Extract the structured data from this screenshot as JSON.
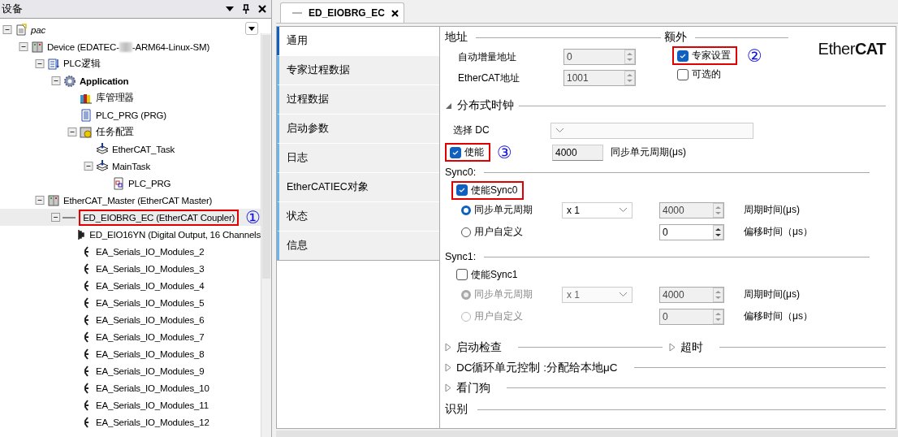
{
  "device_panel": {
    "title": "设备",
    "tree": [
      {
        "label": "pac",
        "kind": "project",
        "selected": false,
        "expanded": true,
        "children": [
          {
            "label": "Device (EDATEC-",
            "label_tail": "-ARM64-Linux-SM)",
            "kind": "device",
            "selected": false,
            "expanded": true,
            "children": [
              {
                "label": "PLC逻辑",
                "kind": "plc",
                "selected": false,
                "expanded": true,
                "children": [
                  {
                    "label": "Application",
                    "kind": "application",
                    "selected": false,
                    "expanded": true,
                    "children": [
                      {
                        "label": "库管理器",
                        "kind": "library",
                        "selected": false
                      },
                      {
                        "label": "PLC_PRG (PRG)",
                        "kind": "program",
                        "selected": false
                      },
                      {
                        "label": "任务配置",
                        "kind": "taskconfig",
                        "selected": false,
                        "expanded": true,
                        "children": [
                          {
                            "label": "EtherCAT_Task",
                            "kind": "task",
                            "selected": false
                          },
                          {
                            "label": "MainTask",
                            "kind": "task",
                            "selected": false,
                            "expanded": true,
                            "children": [
                              {
                                "label": "PLC_PRG",
                                "kind": "call",
                                "selected": false
                              }
                            ]
                          }
                        ]
                      }
                    ]
                  }
                ]
              },
              {
                "label": "EtherCAT_Master (EtherCAT Master)",
                "kind": "device",
                "selected": false,
                "expanded": true,
                "children": [
                  {
                    "label": "ED_EIOBRG_EC (EtherCAT Coupler)",
                    "kind": "coupler",
                    "selected": true,
                    "highlighted": true,
                    "callout": "①",
                    "expanded": true,
                    "children": [
                      {
                        "label": "ED_EIO16YN (Digital Output, 16 Channels",
                        "kind": "module_out",
                        "selected": false
                      },
                      {
                        "label": "EA_Serials_IO_Modules_2",
                        "kind": "module",
                        "selected": false
                      },
                      {
                        "label": "EA_Serials_IO_Modules_3",
                        "kind": "module",
                        "selected": false
                      },
                      {
                        "label": "EA_Serials_IO_Modules_4",
                        "kind": "module",
                        "selected": false
                      },
                      {
                        "label": "EA_Serials_IO_Modules_5",
                        "kind": "module",
                        "selected": false
                      },
                      {
                        "label": "EA_Serials_IO_Modules_6",
                        "kind": "module",
                        "selected": false
                      },
                      {
                        "label": "EA_Serials_IO_Modules_7",
                        "kind": "module",
                        "selected": false
                      },
                      {
                        "label": "EA_Serials_IO_Modules_8",
                        "kind": "module",
                        "selected": false
                      },
                      {
                        "label": "EA_Serials_IO_Modules_9",
                        "kind": "module",
                        "selected": false
                      },
                      {
                        "label": "EA_Serials_IO_Modules_10",
                        "kind": "module",
                        "selected": false
                      },
                      {
                        "label": "EA_Serials_IO_Modules_11",
                        "kind": "module",
                        "selected": false
                      },
                      {
                        "label": "EA_Serials_IO_Modules_12",
                        "kind": "module",
                        "selected": false
                      }
                    ]
                  }
                ]
              }
            ]
          }
        ]
      }
    ]
  },
  "editor_tab": {
    "label": "ED_EIOBRG_EC",
    "selected": true
  },
  "nav": [
    {
      "label": "通用",
      "selected": true
    },
    {
      "label": "专家过程数据",
      "selected": false
    },
    {
      "label": "过程数据",
      "selected": false
    },
    {
      "label": "启动参数",
      "selected": false
    },
    {
      "label": "日志",
      "selected": false
    },
    {
      "label": "EtherCATIEC对象",
      "selected": false
    },
    {
      "label": "状态",
      "selected": false
    },
    {
      "label": "信息",
      "selected": false
    }
  ],
  "address": {
    "title": "地址",
    "fields": [
      {
        "label": "自动增量地址",
        "value": "0",
        "disabled": true
      },
      {
        "label": "EtherCAT地址",
        "value": "1001",
        "disabled": true
      }
    ]
  },
  "extra": {
    "title": "额外",
    "options": [
      {
        "label": "专家设置",
        "checked": true,
        "highlighted": true,
        "callout": "②"
      },
      {
        "label": "可选的",
        "checked": false
      }
    ]
  },
  "logo": "Ether**CAT**",
  "dc": {
    "title": "分布式时钟",
    "expanded": true,
    "select_label": "选择 DC",
    "enable": {
      "label": "使能",
      "checked": true,
      "highlighted": true,
      "callout": "③"
    },
    "cycle_value": "4000",
    "cycle_label": "同步单元周期(μs)"
  },
  "syncs": [
    {
      "title": "Sync0:",
      "disabled": false,
      "enable": {
        "label": "使能Sync0",
        "checked": true,
        "highlighted": true
      },
      "modes": [
        {
          "label": "同步单元周期",
          "selected": true,
          "dropdown": "x 1",
          "value": "4000",
          "value_disabled": true,
          "unit": "周期时间(μs)"
        },
        {
          "label": "用户自定义",
          "selected": false,
          "value": "0",
          "value_disabled": false,
          "unit": "偏移时间（μs）"
        }
      ]
    },
    {
      "title": "Sync1:",
      "disabled": true,
      "enable": {
        "label": "使能Sync1",
        "checked": false
      },
      "modes": [
        {
          "label": "同步单元周期",
          "selected": true,
          "dropdown": "x 1",
          "value": "4000",
          "value_disabled": true,
          "unit": "周期时间(μs)"
        },
        {
          "label": "用户自定义",
          "selected": false,
          "value": "0",
          "value_disabled": true,
          "unit": "偏移时间（μs）"
        }
      ]
    }
  ],
  "collapsed_rows": [
    [
      {
        "title": "启动检查",
        "expanded": false
      },
      {
        "title": "超时",
        "expanded": false
      }
    ],
    [
      {
        "title": "DC循环单元控制 :分配给本地μC",
        "expanded": false
      }
    ],
    [
      {
        "title": "看门狗",
        "expanded": false
      }
    ]
  ],
  "identification": {
    "title": "识别"
  }
}
